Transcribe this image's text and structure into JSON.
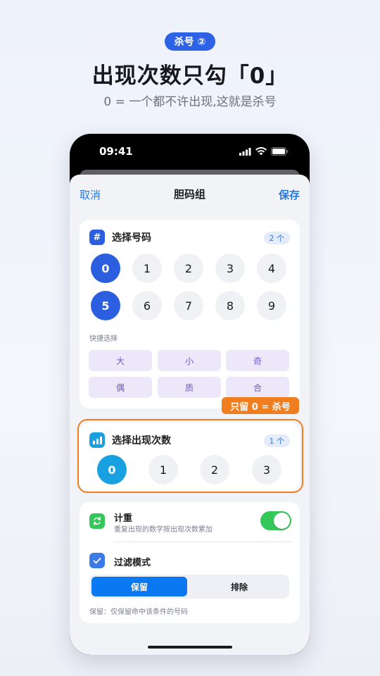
{
  "header": {
    "badge": "杀号 ②",
    "title": "出现次数只勾「0」",
    "subtitle": "0 = 一个都不许出现,这就是杀号"
  },
  "status_bar": {
    "time": "09:41"
  },
  "nav": {
    "cancel": "取消",
    "title": "胆码组",
    "save": "保存"
  },
  "numbers_card": {
    "icon": "hash-icon",
    "title": "选择号码",
    "count": "2 个",
    "numbers": [
      "0",
      "1",
      "2",
      "3",
      "4",
      "5",
      "6",
      "7",
      "8",
      "9"
    ],
    "selected": [
      "0",
      "5"
    ],
    "quick_label": "快捷选择",
    "quick": [
      "大",
      "小",
      "奇",
      "偶",
      "质",
      "合"
    ]
  },
  "callout": "只留 0 = 杀号",
  "times_card": {
    "icon": "bar-chart-icon",
    "title": "选择出现次数",
    "count": "1 个",
    "options": [
      "0",
      "1",
      "2",
      "3"
    ],
    "selected": [
      "0"
    ]
  },
  "settings_card": {
    "weight": {
      "icon": "repeat-icon",
      "title": "计重",
      "subtitle": "重复出现的数字按出现次数累加",
      "enabled": true
    },
    "filter": {
      "icon": "check-icon",
      "title": "过滤模式",
      "options": [
        "保留",
        "排除"
      ],
      "selected": "保留"
    },
    "footnote": "保留：仅保留命中该条件的号码"
  },
  "colors": {
    "primary": "#2b5fe0",
    "accent_orange": "#f07d1e",
    "times_selected": "#18a0e0",
    "toggle_on": "#34c759"
  }
}
